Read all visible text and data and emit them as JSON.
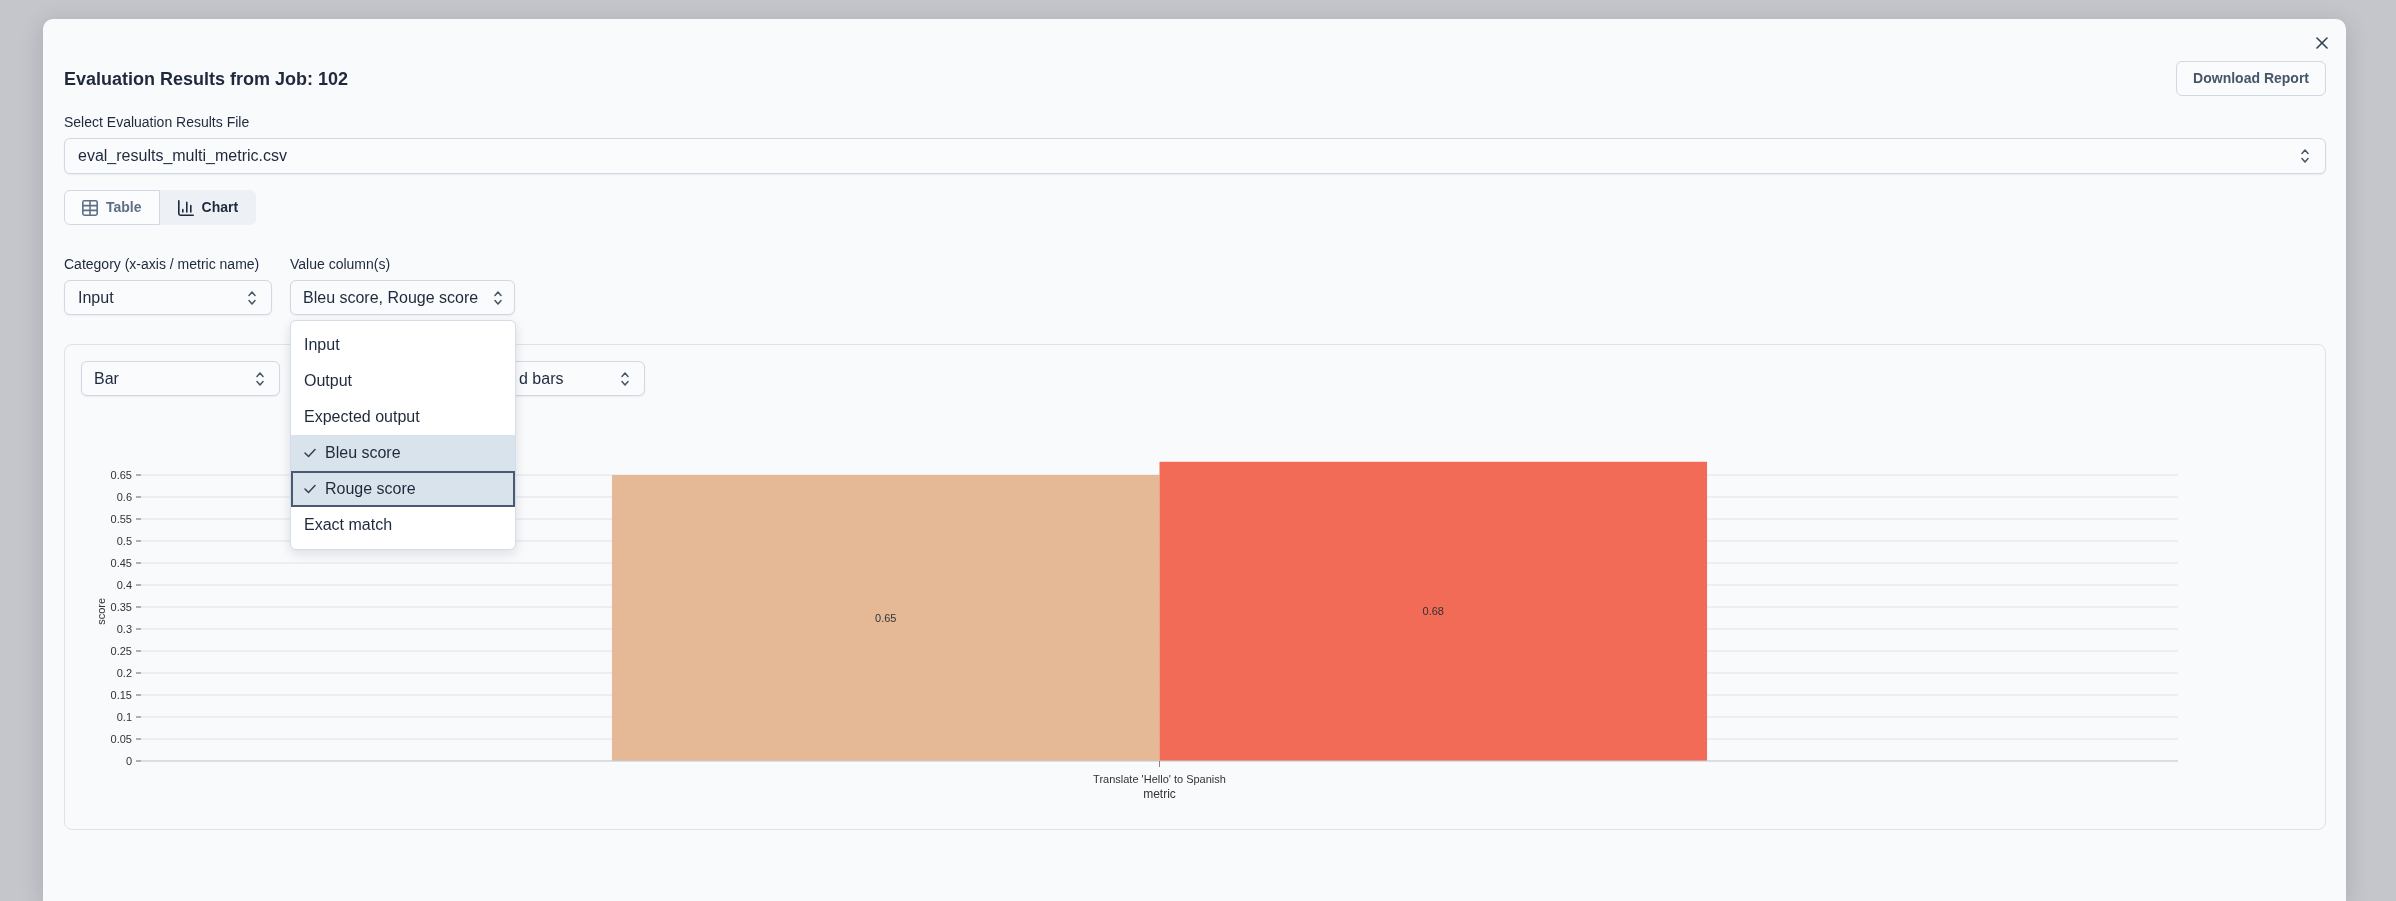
{
  "dialog": {
    "title": "Evaluation Results from Job: 102",
    "download_button": "Download Report"
  },
  "file_select": {
    "label": "Select Evaluation Results File",
    "value": "eval_results_multi_metric.csv"
  },
  "view_tabs": [
    {
      "label": "Table",
      "selected": false
    },
    {
      "label": "Chart",
      "selected": true
    }
  ],
  "category_select": {
    "label": "Category (x-axis / metric name)",
    "value": "Input"
  },
  "value_select": {
    "label": "Value column(s)",
    "value": "Bleu score, Rouge score",
    "expanded": true,
    "options": [
      {
        "label": "Input",
        "checked": false,
        "focused": false
      },
      {
        "label": "Output",
        "checked": false,
        "focused": false
      },
      {
        "label": "Expected output",
        "checked": false,
        "focused": false
      },
      {
        "label": "Bleu score",
        "checked": true,
        "focused": false
      },
      {
        "label": "Rouge score",
        "checked": true,
        "focused": true
      },
      {
        "label": "Exact match",
        "checked": false,
        "focused": false
      }
    ]
  },
  "chart_panel": {
    "chart_type_select": {
      "value": "Bar"
    },
    "layout_select": {
      "value": "d bars"
    },
    "chart_data": {
      "type": "bar",
      "xlabel": "metric",
      "ylabel": "score",
      "categories": [
        "Translate 'Hello' to Spanish"
      ],
      "series": [
        {
          "color": "#e5b896",
          "values": [
            0.65
          ]
        },
        {
          "color": "#f26b57",
          "values": [
            0.68
          ]
        }
      ],
      "ylim": [
        0,
        0.68
      ],
      "yticks": [
        0,
        0.05,
        0.1,
        0.15,
        0.2,
        0.25,
        0.3,
        0.35,
        0.4,
        0.45,
        0.5,
        0.55,
        0.6,
        0.65
      ],
      "grid": true,
      "data_labels": true
    }
  }
}
